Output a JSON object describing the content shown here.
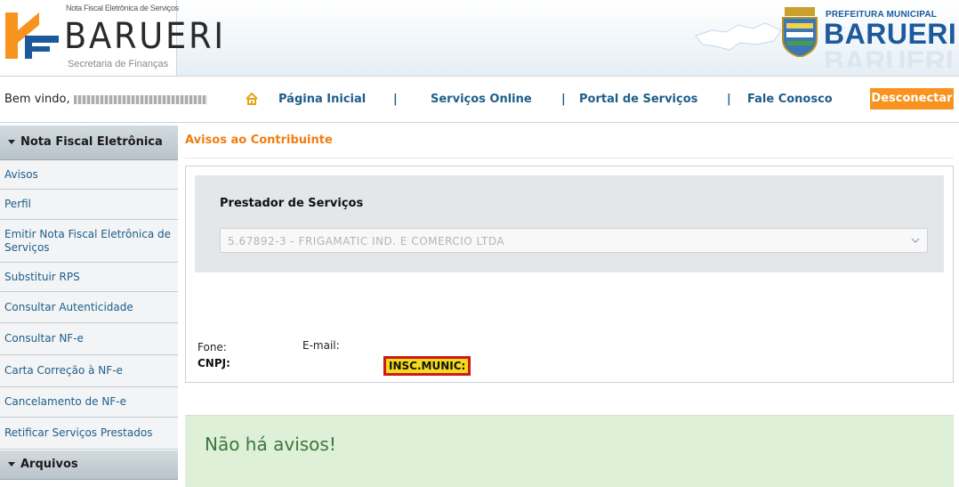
{
  "header": {
    "logo_small_text": "Nota Fiscal Eletrônica de Serviços",
    "logo_name": "BARUERI",
    "logo_subtitle": "Secretaria de Finanças",
    "prefeitura_label": "PREFEITURA MUNICIPAL",
    "prefeitura_name": "BARUERI",
    "colors": {
      "brand_orange": "#f7931e",
      "brand_blue": "#1c5a9c"
    }
  },
  "nav": {
    "welcome_label": "Bem vindo,",
    "home_icon": "home-icon",
    "links": [
      "Página Inicial",
      "Serviços Online",
      "Portal de Serviços",
      "Fale Conosco"
    ],
    "separator": "|",
    "logout_label": "Desconectar"
  },
  "sidebar": {
    "section1_title": "Nota Fiscal Eletrônica",
    "items": [
      "Avisos",
      "Perfil",
      "Emitir Nota Fiscal Eletrônica de Serviços",
      "Substituir RPS",
      "Consultar Autenticidade",
      "Consultar NF-e",
      "Carta Correção à  NF-e",
      "Cancelamento de NF-e",
      "Retificar Serviços Prestados"
    ],
    "section2_title": "Arquivos"
  },
  "main": {
    "title": "Avisos ao Contribuinte",
    "prestador_label": "Prestador de Serviços",
    "select_value": "5.67892-3 - FRIGAMATIC IND. E COMERCIO LTDA",
    "fone_label": "Fone:",
    "email_label": "E-mail:",
    "cnpj_label": "CNPJ:",
    "insc_label": "INSC.MUNIC:",
    "notice_text": "Não há avisos!",
    "colors": {
      "title_orange": "#f07d10",
      "notice_bg": "#dff0d8",
      "notice_text": "#3c763d",
      "highlight": "#f4dc1c",
      "highlight_border": "#d01818"
    }
  }
}
